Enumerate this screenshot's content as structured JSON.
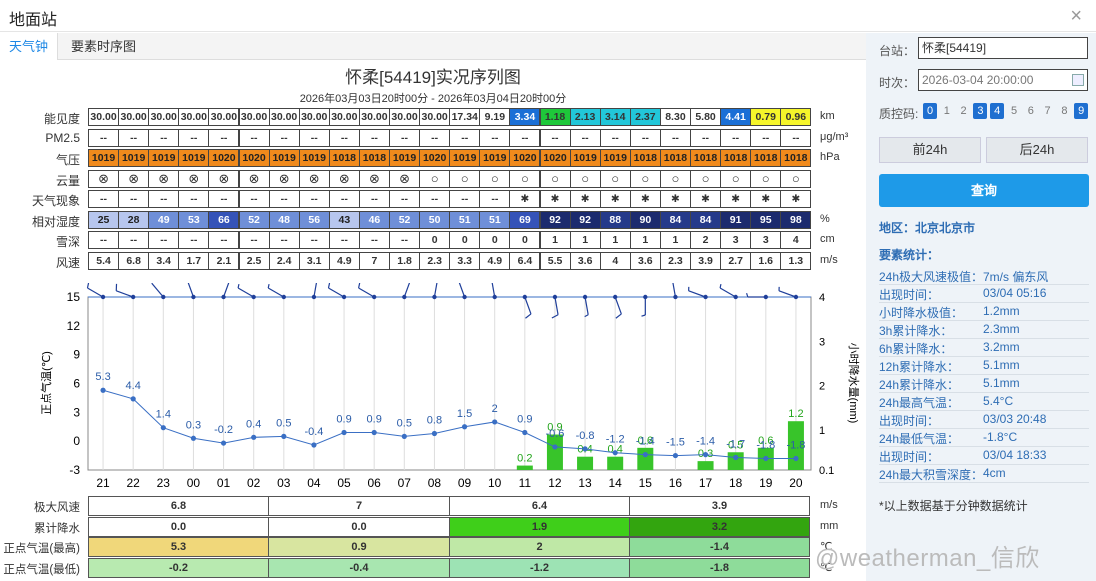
{
  "window": {
    "title": "地面站",
    "close": "×"
  },
  "tabs": [
    "天气钟",
    "要素时序图"
  ],
  "chart": {
    "title": "怀柔[54419]实况序列图",
    "subtitle": "2026年03月03日20时00分 - 2026年03月04日20时00分"
  },
  "rows": [
    {
      "label": "能见度",
      "unit": "km",
      "values": [
        "30.00",
        "30.00",
        "30.00",
        "30.00",
        "30.00",
        "30.00",
        "30.00",
        "30.00",
        "30.00",
        "30.00",
        "30.00",
        "30.00",
        "17.34",
        "9.19",
        "3.34",
        "1.18",
        "2.13",
        "3.14",
        "2.37",
        "8.30",
        "5.80",
        "4.41",
        "0.79",
        "0.96"
      ],
      "colors": [
        "#ffffff",
        "#ffffff",
        "#ffffff",
        "#ffffff",
        "#ffffff",
        "#ffffff",
        "#ffffff",
        "#ffffff",
        "#ffffff",
        "#ffffff",
        "#ffffff",
        "#ffffff",
        "#ffffff",
        "#ffffff",
        "#1a6fd6",
        "#1ec83a",
        "#22c7d9",
        "#22c7d9",
        "#22c7d9",
        "#ffffff",
        "#ffffff",
        "#1a6fd6",
        "#f5f52a",
        "#f5f52a"
      ]
    },
    {
      "label": "PM2.5",
      "unit": "μg/m³",
      "values": [
        "--",
        "--",
        "--",
        "--",
        "--",
        "--",
        "--",
        "--",
        "--",
        "--",
        "--",
        "--",
        "--",
        "--",
        "--",
        "--",
        "--",
        "--",
        "--",
        "--",
        "--",
        "--",
        "--",
        "--"
      ]
    },
    {
      "label": "气压",
      "unit": "hPa",
      "values": [
        "1019",
        "1019",
        "1019",
        "1019",
        "1020",
        "1020",
        "1019",
        "1019",
        "1018",
        "1018",
        "1019",
        "1020",
        "1019",
        "1019",
        "1020",
        "1020",
        "1019",
        "1019",
        "1018",
        "1018",
        "1018",
        "1018",
        "1018",
        "1018"
      ]
    },
    {
      "label": "云量",
      "unit": "",
      "values": [
        "⊗",
        "⊗",
        "⊗",
        "⊗",
        "⊗",
        "⊗",
        "⊗",
        "⊗",
        "⊗",
        "⊗",
        "⊗",
        "○",
        "○",
        "○",
        "○",
        "○",
        "○",
        "○",
        "○",
        "○",
        "○",
        "○",
        "○",
        "○"
      ]
    },
    {
      "label": "天气现象",
      "unit": "",
      "values": [
        "--",
        "--",
        "--",
        "--",
        "--",
        "--",
        "--",
        "--",
        "--",
        "--",
        "--",
        "--",
        "--",
        "--",
        "✱",
        "✱",
        "✱",
        "✱",
        "✱",
        "✱",
        "✱",
        "✱",
        "✱",
        "✱"
      ]
    },
    {
      "label": "相对湿度",
      "unit": "%",
      "values": [
        "25",
        "28",
        "49",
        "53",
        "66",
        "52",
        "48",
        "56",
        "43",
        "46",
        "52",
        "50",
        "51",
        "51",
        "69",
        "92",
        "92",
        "88",
        "90",
        "84",
        "84",
        "91",
        "95",
        "98"
      ]
    },
    {
      "label": "雪深",
      "unit": "cm",
      "values": [
        "--",
        "--",
        "--",
        "--",
        "--",
        "--",
        "--",
        "--",
        "--",
        "--",
        "--",
        "0",
        "0",
        "0",
        "0",
        "1",
        "1",
        "1",
        "1",
        "1",
        "2",
        "3",
        "3",
        "4"
      ]
    },
    {
      "label": "风速",
      "unit": "m/s",
      "values": [
        "5.4",
        "6.8",
        "3.4",
        "1.7",
        "2.1",
        "2.5",
        "2.4",
        "3.1",
        "4.9",
        "7",
        "1.8",
        "2.3",
        "3.3",
        "4.9",
        "6.4",
        "5.5",
        "3.6",
        "4",
        "3.6",
        "2.3",
        "3.9",
        "2.7",
        "1.6",
        "1.3"
      ]
    }
  ],
  "hours": [
    "21",
    "22",
    "23",
    "00",
    "01",
    "02",
    "03",
    "04",
    "05",
    "06",
    "07",
    "08",
    "09",
    "10",
    "11",
    "12",
    "13",
    "14",
    "15",
    "16",
    "17",
    "18",
    "19",
    "20"
  ],
  "axes": {
    "left_label": "正点气温(℃)",
    "right_label": "小时降水量(mm)",
    "left_ticks": [
      "15",
      "12",
      "9",
      "6",
      "3",
      "0",
      "-3"
    ],
    "right_ticks": [
      "4",
      "3",
      "2",
      "1",
      "0.1"
    ]
  },
  "chart_data": {
    "type": "line+bar",
    "temperature": [
      5.3,
      4.4,
      1.4,
      0.3,
      -0.2,
      0.4,
      0.5,
      -0.4,
      0.9,
      0.9,
      0.5,
      0.8,
      1.5,
      2,
      0.9,
      -0.6,
      -0.8,
      -1.2,
      -1.4,
      -1.5,
      -1.4,
      -1.7,
      -1.8,
      -1.8
    ],
    "temp_labels": [
      "5.3",
      "4.4",
      "1.4",
      "0.3",
      "-0.2",
      "0.4",
      "0.5",
      "-0.4",
      "0.9",
      "0.9",
      "0.5",
      "0.8",
      "1.5",
      "2",
      "0.9",
      "-0.6",
      "-0.8",
      "-1.2",
      "-1.4",
      "-1.5",
      "-1.4",
      "-1.7",
      "-1.8",
      "-1.8"
    ],
    "precip": [
      0,
      0,
      0,
      0,
      0,
      0,
      0,
      0,
      0,
      0,
      0,
      0,
      0,
      0,
      0.2,
      0.9,
      0.4,
      0.4,
      0.6,
      0,
      0.3,
      0.5,
      0.6,
      1.2
    ],
    "precip_labels": [
      "",
      "",
      "",
      "",
      "",
      "",
      "",
      "",
      "",
      "",
      "",
      "",
      "",
      "",
      "0.2",
      "0.9",
      "0.4",
      "0.4",
      "0.6",
      "",
      "0.3",
      "0.5",
      "0.6",
      "1.2"
    ],
    "wind_speed": [
      5.4,
      6.8,
      3.4,
      1.7,
      2.1,
      2.5,
      2.4,
      3.1,
      4.9,
      7,
      1.8,
      2.3,
      3.3,
      4.9,
      6.4,
      5.5,
      3.6,
      4,
      3.6,
      2.3,
      3.9,
      2.7,
      1.6,
      1.3
    ],
    "wind_dir": [
      300,
      290,
      320,
      340,
      20,
      300,
      300,
      10,
      300,
      300,
      20,
      10,
      340,
      350,
      160,
      170,
      170,
      160,
      180,
      350,
      290,
      300,
      270,
      290
    ]
  },
  "bottom": {
    "rows": [
      {
        "label": "极大风速",
        "unit": "m/s",
        "values": [
          "6.8",
          "7",
          "6.4",
          "3.9"
        ],
        "colors": [
          "#ffffff",
          "#ffffff",
          "#ffffff",
          "#ffffff"
        ]
      },
      {
        "label": "累计降水",
        "unit": "mm",
        "values": [
          "0.0",
          "0.0",
          "1.9",
          "3.2"
        ],
        "colors": [
          "#ffffff",
          "#ffffff",
          "#3fcf1a",
          "#33a50f"
        ]
      },
      {
        "label": "正点气温(最高)",
        "unit": "℃",
        "values": [
          "5.3",
          "0.9",
          "2",
          "-1.4"
        ],
        "colors": [
          "#f0d77a",
          "#d8e5a0",
          "#bfe8a6",
          "#8edc9a"
        ]
      },
      {
        "label": "正点气温(最低)",
        "unit": "℃",
        "values": [
          "-0.2",
          "-0.4",
          "-1.2",
          "-1.8"
        ],
        "colors": [
          "#b8eab0",
          "#a8e6b0",
          "#9de3b4",
          "#8edc9a"
        ]
      }
    ]
  },
  "side": {
    "station_label": "台站：",
    "station_value": "怀柔[54419]",
    "time_label": "时次：",
    "time_value": "2026-03-04 20:00:00",
    "qc_label": "质控码:",
    "qc": [
      "0",
      "1",
      "2",
      "3",
      "4",
      "5",
      "6",
      "7",
      "8",
      "9"
    ],
    "qc_active": [
      true,
      false,
      false,
      true,
      true,
      false,
      false,
      false,
      false,
      true
    ],
    "prev": "前24h",
    "next": "后24h",
    "query": "查询",
    "region": "地区：北京北京市",
    "stats_title": "要素统计：",
    "stats": [
      [
        "24h极大风速极值：",
        "7m/s 偏东风"
      ],
      [
        "出现时间：",
        "03/04 05:16"
      ],
      [
        "小时降水极值：",
        "1.2mm"
      ],
      [
        "3h累计降水：",
        "2.3mm"
      ],
      [
        "6h累计降水：",
        "3.2mm"
      ],
      [
        "12h累计降水：",
        "5.1mm"
      ],
      [
        "24h累计降水：",
        "5.1mm"
      ],
      [
        "24h最高气温：",
        "5.4°C"
      ],
      [
        "出现时间：",
        "03/03 20:48"
      ],
      [
        "24h最低气温：",
        "-1.8°C"
      ],
      [
        "出现时间：",
        "03/04 18:33"
      ],
      [
        "24h最大积雪深度：",
        "4cm"
      ]
    ],
    "note": "*以上数据基于分钟数据统计"
  },
  "watermark": "@weatherman_信欣",
  "colors": {
    "pressure": "#f08a1c",
    "accent": "#1e9ae8",
    "line": "#3a6fc4",
    "bar": "#38c42a"
  }
}
